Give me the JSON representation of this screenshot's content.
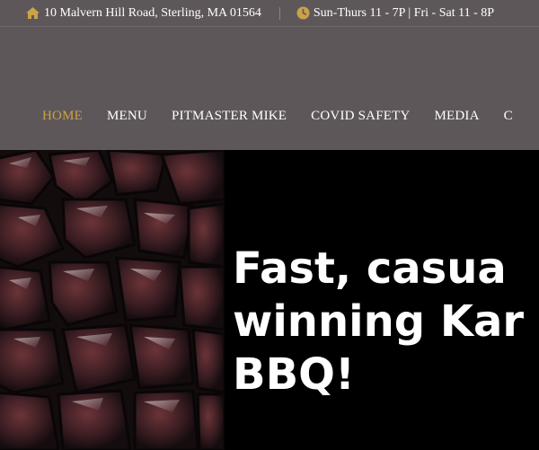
{
  "topbar": {
    "address": "10 Malvern Hill Road, Sterling, MA 01564",
    "hours": "Sun-Thurs 11 - 7P | Fri - Sat 11 - 8P",
    "icons": {
      "address_icon": "home-icon",
      "hours_icon": "clock-icon"
    },
    "icon_color": "#c9a24a"
  },
  "nav": {
    "items": [
      "HOME",
      "MENU",
      "PITMASTER MIKE",
      "COVID SAFETY",
      "MEDIA",
      "C"
    ],
    "active_index": 0,
    "active_color": "#c9a24a"
  },
  "hero": {
    "line1": "Fast, casua",
    "line2": "winning Kar",
    "line3": "BBQ!"
  },
  "colors": {
    "header_bg": "#5e5759",
    "hero_bg": "#000000",
    "text": "#ffffff"
  }
}
